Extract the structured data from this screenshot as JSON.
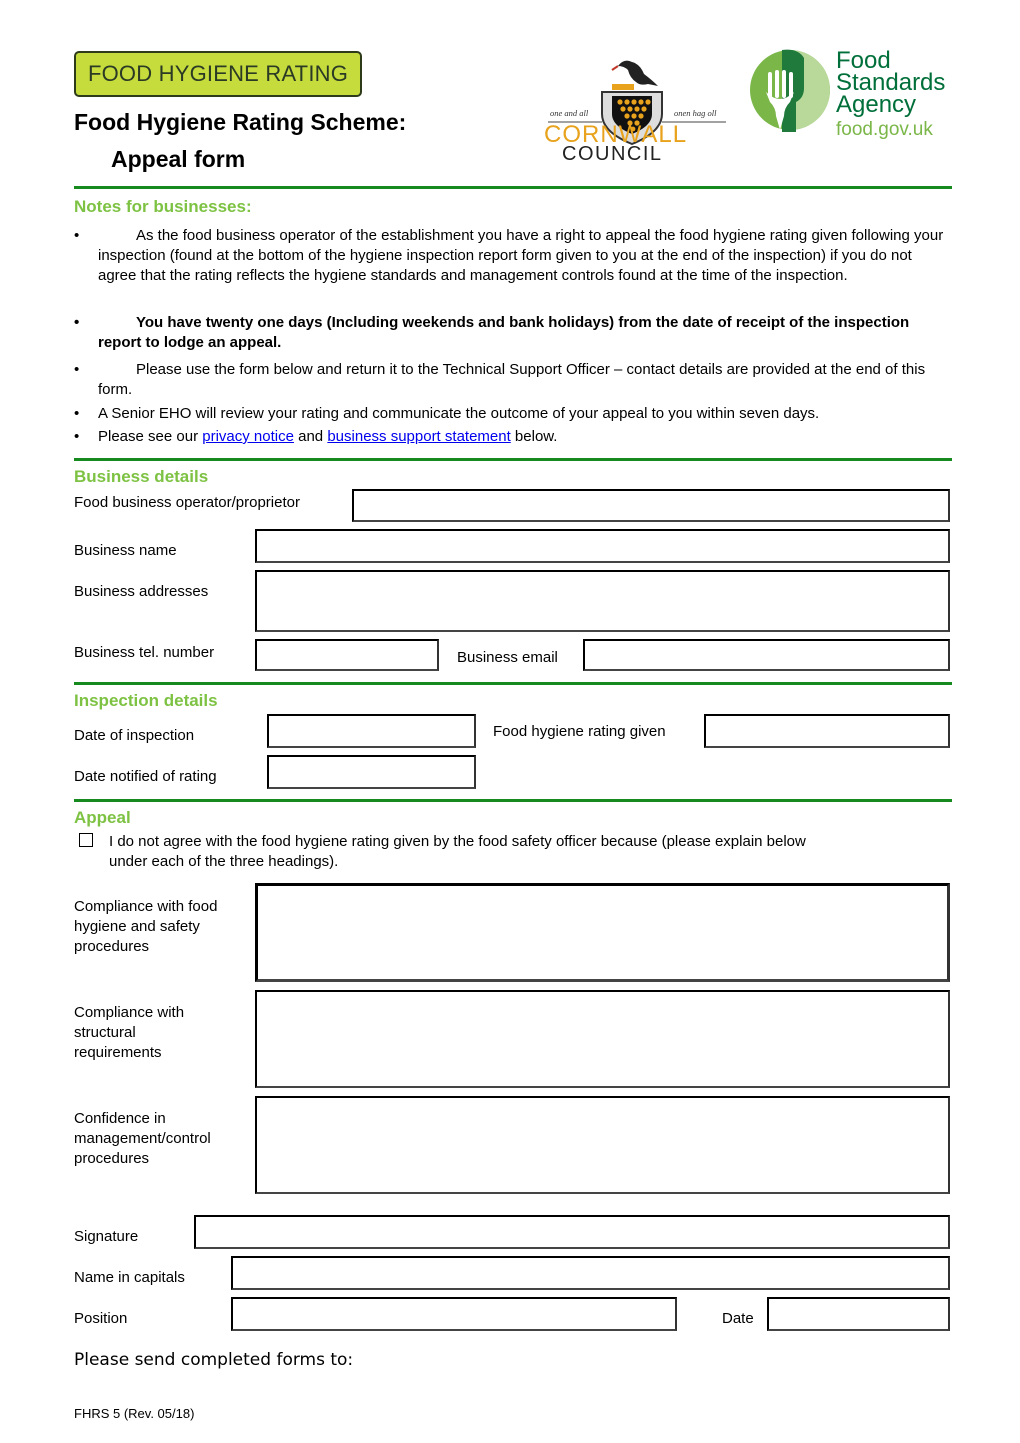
{
  "header": {
    "badge_text": "FOOD HYGIENE RATING",
    "title_line1": "Food Hygiene Rating Scheme:",
    "title_line2": "Appeal form",
    "council_logo": {
      "motto_left": "one and all",
      "motto_right": "onen hag oll",
      "name_line1": "CORNWALL",
      "name_line2": "COUNCIL"
    },
    "fsa_logo": {
      "line1": "Food",
      "line2": "Standards",
      "line3": "Agency",
      "url": "food.gov.uk"
    }
  },
  "colors": {
    "rule_green": "#178a1f",
    "heading_green": "#7dc243",
    "badge_lime": "#c5dc3c",
    "link_blue": "#0000ee",
    "cornwall_gold": "#e8a21c",
    "fsa_green": "#006f3a"
  },
  "notes": {
    "heading": "Notes for businesses:",
    "items": [
      {
        "text": "As the food business operator of the establishment you have a right to appeal the food hygiene rating given following your inspection (found at the bottom of the hygiene inspection report form given to you at the end of the inspection) if you do not agree that the rating reflects the hygiene standards and management controls found at the time of the inspection."
      },
      {
        "text": "You have twenty one days (Including weekends and bank holidays) from the date of receipt of the inspection report to lodge an appeal."
      },
      {
        "text": "Please use the form below and return it to the Technical Support Officer – contact details are provided at the end of this form."
      },
      {
        "text": "A Senior EHO will review your rating and communicate the outcome of your appeal to you within seven days."
      },
      {
        "prefix": "Please see our ",
        "link1": "privacy notice",
        "middle": " and ",
        "link2": "business support statement",
        "suffix": " below."
      }
    ]
  },
  "business_details": {
    "heading": "Business details",
    "operator_label": "Food business operator/proprietor",
    "operator_value": "",
    "name_label": "Business name",
    "name_value": "",
    "address_label": "Business addresses",
    "address_value": "",
    "tel_label": "Business tel. number",
    "tel_value": "",
    "email_label": "Business email",
    "email_value": ""
  },
  "inspection_details": {
    "heading": "Inspection details",
    "date_label": "Date of inspection",
    "date_value": "",
    "rating_label": "Food hygiene rating given",
    "rating_value": "",
    "notified_label": "Date notified of rating",
    "notified_value": ""
  },
  "appeal": {
    "heading": "Appeal",
    "checkbox_checked": false,
    "checkbox_text_line1": "I do not agree with the food hygiene rating given by the food safety officer because (please explain below",
    "checkbox_text_line2": "under each of the three headings).",
    "fields": [
      {
        "label_lines": [
          "Compliance with food",
          "hygiene and safety",
          "procedures"
        ],
        "value": ""
      },
      {
        "label_lines": [
          "Compliance with",
          "structural",
          "requirements"
        ],
        "value": ""
      },
      {
        "label_lines": [
          "Confidence in",
          "management/control",
          "procedures"
        ],
        "value": ""
      }
    ]
  },
  "signoff": {
    "signature_label": "Signature",
    "signature_value": "",
    "name_label": "Name in capitals",
    "name_value": "",
    "position_label": "Position",
    "position_value": "",
    "date_label": "Date",
    "date_value": ""
  },
  "send_text": "Please send completed forms to:",
  "footer": "FHRS 5 (Rev. 05/18)"
}
